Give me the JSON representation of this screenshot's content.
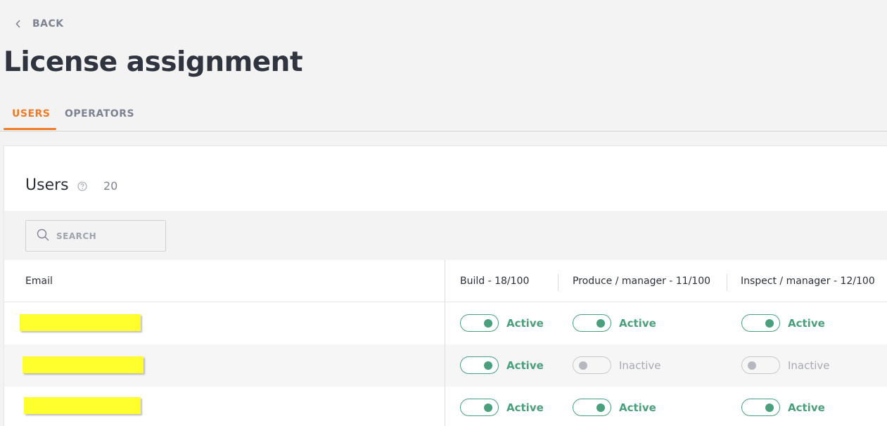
{
  "nav": {
    "back_label": "BACK"
  },
  "page": {
    "title": "License assignment"
  },
  "tabs": [
    {
      "label": "USERS",
      "active": true
    },
    {
      "label": "OPERATORS",
      "active": false
    }
  ],
  "users_section": {
    "title": "Users",
    "count": "20",
    "search_placeholder": "SEARCH"
  },
  "table": {
    "columns": {
      "email": "Email",
      "build": "Build - 18/100",
      "produce": "Produce / manager - 11/100",
      "inspect": "Inspect / manager - 12/100"
    },
    "rows": [
      {
        "email": "",
        "build": "Active",
        "produce": "Active",
        "inspect": "Active"
      },
      {
        "email": "",
        "build": "Active",
        "produce": "Inactive",
        "inspect": "Inactive"
      },
      {
        "email": "",
        "build": "Active",
        "produce": "Active",
        "inspect": "Active"
      }
    ]
  },
  "colors": {
    "accent": "#f07a26",
    "active": "#4aa07c",
    "inactive": "#a7aab1",
    "redaction": "#ffff2e"
  },
  "icons": {
    "back": "chevron-left-icon",
    "help": "question-circle-icon",
    "search": "search-icon"
  }
}
